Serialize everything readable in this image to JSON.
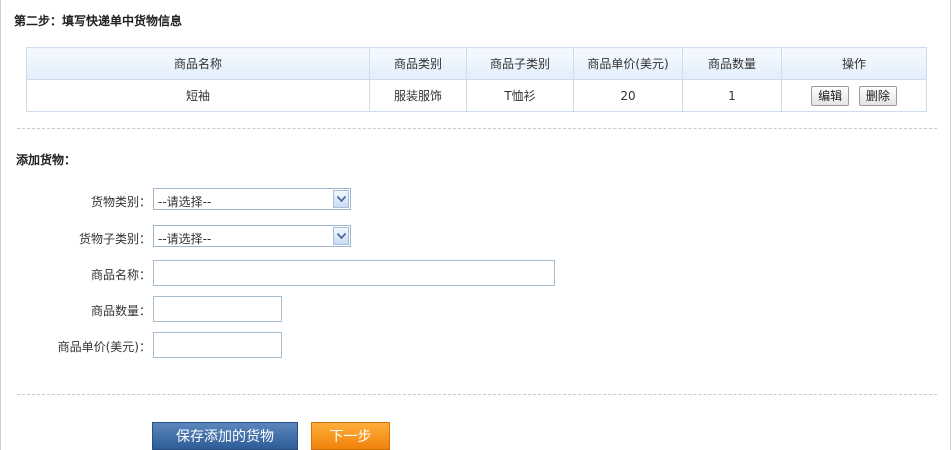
{
  "step_title": "第二步：填写快递单中货物信息",
  "goods_table": {
    "headers": [
      "商品名称",
      "商品类别",
      "商品子类别",
      "商品单价(美元)",
      "商品数量",
      "操作"
    ],
    "rows": [
      {
        "name": "短袖",
        "category": "服装服饰",
        "subcategory": "T恤衫",
        "price": "20",
        "quantity": "1",
        "edit_label": "编辑",
        "delete_label": "删除"
      }
    ]
  },
  "add_section": {
    "title": "添加货物：",
    "category": {
      "label": "货物类别：",
      "selected": "--请选择--"
    },
    "subcategory": {
      "label": "货物子类别：",
      "selected": "--请选择--"
    },
    "product_name": {
      "label": "商品名称：",
      "value": ""
    },
    "quantity": {
      "label": "商品数量：",
      "value": ""
    },
    "unit_price": {
      "label": "商品单价(美元)：",
      "value": ""
    }
  },
  "buttons": {
    "save_label": "保存添加的货物",
    "next_label": "下一步"
  },
  "colors": {
    "primary_button": "#3a6aa6",
    "next_button": "#f7941d",
    "table_header": "#e6f0fb"
  }
}
